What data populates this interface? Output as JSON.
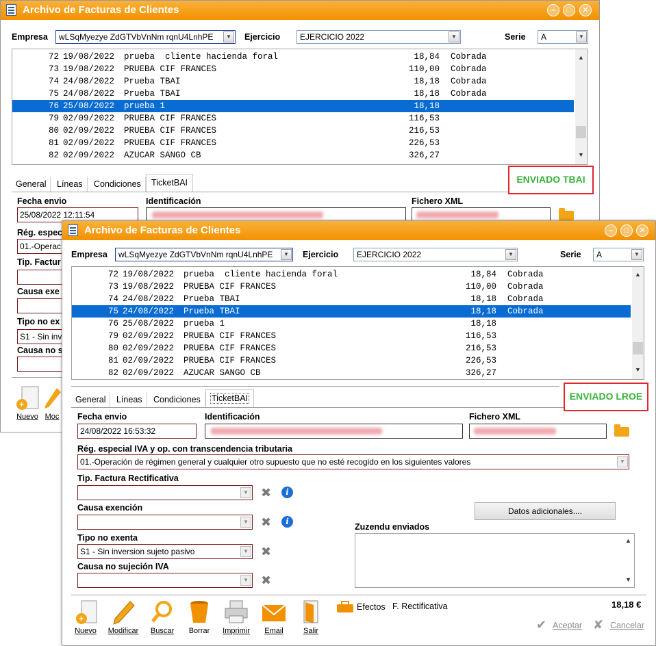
{
  "window": {
    "title": "Archivo de Facturas de Clientes"
  },
  "filters": {
    "empresa_label": "Empresa",
    "empresa_value": "wLSqMyezye ZdGTVbVnNm rqnU4LnhPE",
    "ejercicio_label": "Ejercicio",
    "ejercicio_value": "EJERCICIO 2022",
    "serie_label": "Serie",
    "serie_value": "A"
  },
  "back_rows": [
    {
      "num": "72",
      "date": "19/08/2022",
      "client": "prueba  cliente hacienda foral",
      "amount": "18,84",
      "status": "Cobrada"
    },
    {
      "num": "73",
      "date": "19/08/2022",
      "client": "PRUEBA CIF FRANCES",
      "amount": "110,00",
      "status": "Cobrada"
    },
    {
      "num": "74",
      "date": "24/08/2022",
      "client": "Prueba TBAI",
      "amount": "18,18",
      "status": "Cobrada"
    },
    {
      "num": "75",
      "date": "24/08/2022",
      "client": "Prueba TBAI",
      "amount": "18,18",
      "status": "Cobrada"
    },
    {
      "num": "76",
      "date": "25/08/2022",
      "client": "prueba 1",
      "amount": "18,18",
      "status": ""
    },
    {
      "num": "79",
      "date": "02/09/2022",
      "client": "PRUEBA CIF FRANCES",
      "amount": "116,53",
      "status": ""
    },
    {
      "num": "80",
      "date": "02/09/2022",
      "client": "PRUEBA CIF FRANCES",
      "amount": "216,53",
      "status": ""
    },
    {
      "num": "81",
      "date": "02/09/2022",
      "client": "PRUEBA CIF FRANCES",
      "amount": "226,53",
      "status": ""
    },
    {
      "num": "82",
      "date": "02/09/2022",
      "client": "AZUCAR SANGO CB",
      "amount": "326,27",
      "status": ""
    }
  ],
  "front_rows": [
    {
      "num": "72",
      "date": "19/08/2022",
      "client": "prueba  cliente hacienda foral",
      "amount": "18,84",
      "status": "Cobrada"
    },
    {
      "num": "73",
      "date": "19/08/2022",
      "client": "PRUEBA CIF FRANCES",
      "amount": "110,00",
      "status": "Cobrada"
    },
    {
      "num": "74",
      "date": "24/08/2022",
      "client": "Prueba TBAI",
      "amount": "18,18",
      "status": "Cobrada"
    },
    {
      "num": "75",
      "date": "24/08/2022",
      "client": "Prueba TBAI",
      "amount": "18,18",
      "status": "Cobrada"
    },
    {
      "num": "76",
      "date": "25/08/2022",
      "client": "prueba 1",
      "amount": "18,18",
      "status": ""
    },
    {
      "num": "79",
      "date": "02/09/2022",
      "client": "PRUEBA CIF FRANCES",
      "amount": "116,53",
      "status": ""
    },
    {
      "num": "80",
      "date": "02/09/2022",
      "client": "PRUEBA CIF FRANCES",
      "amount": "216,53",
      "status": ""
    },
    {
      "num": "81",
      "date": "02/09/2022",
      "client": "PRUEBA CIF FRANCES",
      "amount": "226,53",
      "status": ""
    },
    {
      "num": "82",
      "date": "02/09/2022",
      "client": "AZUCAR SANGO CB",
      "amount": "326,27",
      "status": ""
    }
  ],
  "tabs": {
    "general": "General",
    "lineas": "Líneas",
    "condiciones": "Condiciones",
    "ticketbai": "TicketBAI"
  },
  "back": {
    "status": "ENVIADO TBAI",
    "fecha_envio": "25/08/2022 12:11:54",
    "reg_value_partial": "01.-Operac",
    "tipo_no_exenta_partial": "S1 - Sin inv",
    "reg_label_partial": "Rég. espec",
    "tip_label_partial": "Tip. Factur",
    "causa_label_partial": "Causa exe",
    "tipo_label_partial": "Tipo no ex",
    "causa_no_label_partial": "Causa no s",
    "nuevo_partial": "Nuevo",
    "modif_partial": "Moc"
  },
  "form": {
    "fecha_label": "Fecha envio",
    "fecha_value": "24/08/2022 16:53:32",
    "ident_label": "Identificación",
    "fichero_label": "Fichero XML",
    "reg_label": "Rég. especial IVA y op. con transcendencia tributaria",
    "reg_value": "01.-Operación de régimen general y cualquier otro supuesto que no esté recogido en los siguientes valores",
    "tip_label": "Tip. Factura Rectificativa",
    "causa_label": "Causa exención",
    "tipo_label": "Tipo no exenta",
    "tipo_value": "S1 - Sin inversion sujeto pasivo",
    "causa_no_label": "Causa no sujeción IVA",
    "datos_button": "Datos adicionales....",
    "zuzendu_label": "Zuzendu enviados",
    "status": "ENVIADO LROE"
  },
  "toolbar": {
    "nuevo": "Nuevo",
    "modificar": "Modificar",
    "buscar": "Buscar",
    "borrar": "Borrar",
    "imprimir": "Imprimir",
    "email": "Email",
    "salir": "Salir",
    "efectos": "Efectos",
    "f_rectificativa": "F. Rectificativa",
    "total": "18,18 €",
    "aceptar": "Aceptar",
    "cancelar": "Cancelar"
  },
  "colors": {
    "title_orange": "#f29100",
    "selection": "#0a6cd2",
    "status_green": "#36b33a",
    "status_border": "#e1262c",
    "field_border": "#7a1a1a"
  }
}
